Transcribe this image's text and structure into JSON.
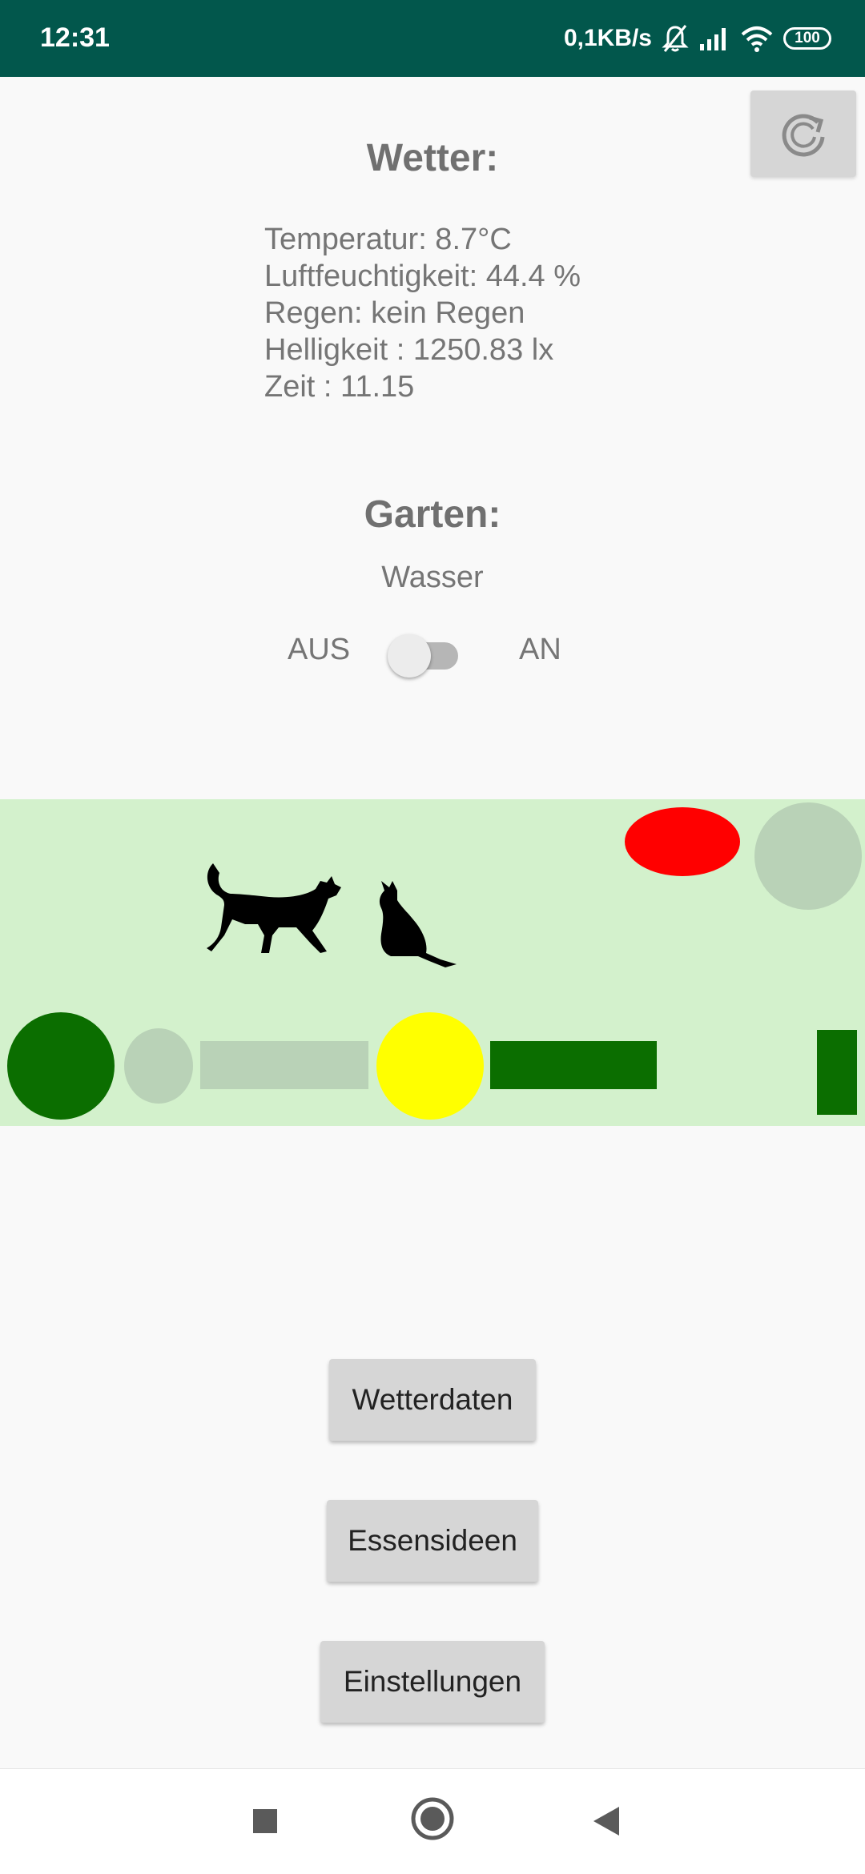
{
  "status_bar": {
    "time": "12:31",
    "network_speed": "0,1KB/s",
    "battery": "100"
  },
  "weather": {
    "title": "Wetter:",
    "temperature": "Temperatur: 8.7°C",
    "humidity": "Luftfeuchtigkeit: 44.4 %",
    "rain": "Regen: kein Regen",
    "brightness": "Helligkeit : 1250.83 lx",
    "time": "Zeit : 11.15"
  },
  "garden": {
    "title": "Garten:",
    "water_label": "Wasser",
    "switch_off_label": "AUS",
    "switch_on_label": "AN",
    "switch_on": false
  },
  "buttons": {
    "weather_data": "Wetterdaten",
    "food_ideas": "Essensideen",
    "settings": "Einstellungen"
  },
  "colors": {
    "status_bar": "#02574c",
    "garden_background": "#d3f1cc",
    "dark_green": "#0b6e00",
    "light_grey_green": "#b9d2b7",
    "red": "#ff0000",
    "yellow": "#ffff00"
  },
  "icons": {
    "refresh": "refresh-icon",
    "cat": "cat-icon",
    "nav_recents": "square-icon",
    "nav_home": "circle-icon",
    "nav_back": "triangle-back-icon"
  }
}
